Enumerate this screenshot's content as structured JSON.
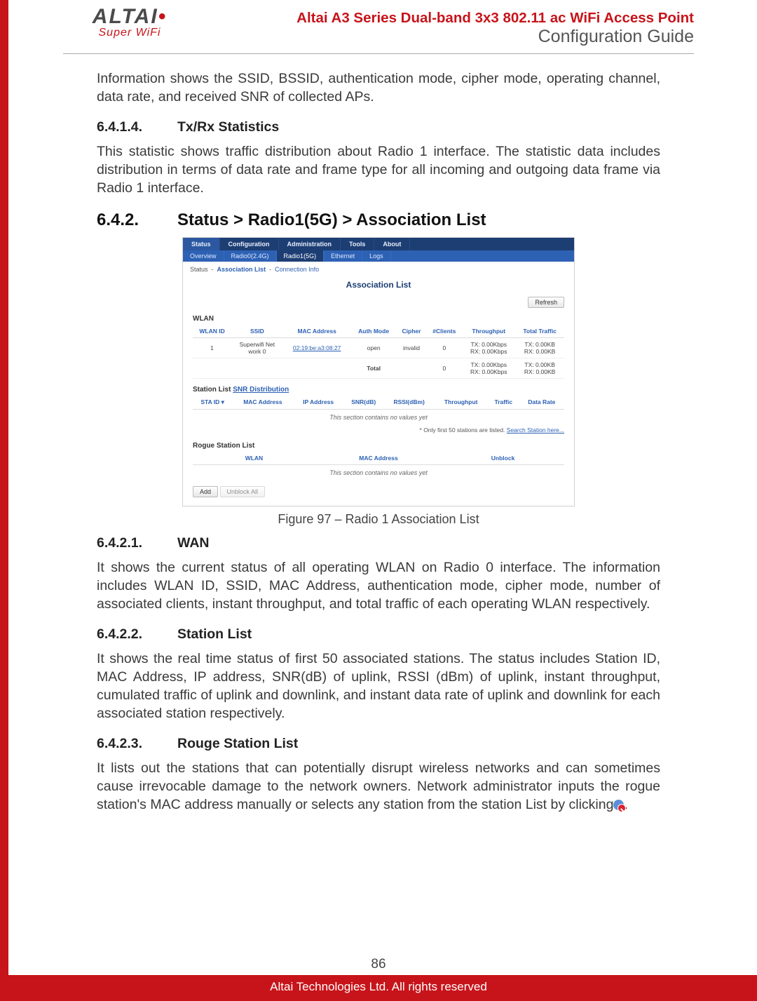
{
  "header": {
    "logo_top": "ALTAI",
    "logo_sub": "Super WiFi",
    "line1": "Altai A3 Series Dual-band 3x3 802.11 ac WiFi Access Point",
    "line2": "Configuration Guide"
  },
  "intro_p": "Information shows the SSID, BSSID, authentication mode, cipher mode, operating channel, data rate, and received SNR of collected APs.",
  "s6414": {
    "num": "6.4.1.4.",
    "title": "Tx/Rx Statistics",
    "p": "This statistic shows traffic distribution about Radio 1 interface. The statistic data includes distribution in terms of data rate and frame type for all incoming and outgoing data frame via Radio 1 interface."
  },
  "s642": {
    "num": "6.4.2.",
    "title": "Status > Radio1(5G) > Association List"
  },
  "figure_caption": "Figure 97 – Radio 1 Association List",
  "s6421": {
    "num": "6.4.2.1.",
    "title": "WAN",
    "p": "It shows the current status of all operating WLAN on Radio 0 interface. The information includes WLAN ID, SSID, MAC Address, authentication mode, cipher mode, number of associated clients, instant throughput, and total traffic of each operating WLAN respectively."
  },
  "s6422": {
    "num": "6.4.2.2.",
    "title": "Station List",
    "p": "It shows the real time status of first 50 associated stations. The status includes Station ID, MAC Address, IP address, SNR(dB) of uplink, RSSI (dBm) of uplink, instant throughput, cumulated traffic of uplink and downlink, and instant data rate of uplink and downlink for each associated station respectively."
  },
  "s6423": {
    "num": "6.4.2.3.",
    "title": "Rouge Station List",
    "p_pre": "It lists out the stations that can potentially disrupt wireless networks and can sometimes cause irrevocable damage to the network owners. Network administrator inputs the rogue station's MAC address manually or selects any station from the station List by clicking",
    "p_post": "."
  },
  "shot": {
    "tabs1": [
      "Status",
      "Configuration",
      "Administration",
      "Tools",
      "About"
    ],
    "tabs2": [
      "Overview",
      "Radio0(2.4G)",
      "Radio1(5G)",
      "Ethernet",
      "Logs"
    ],
    "crumb_status": "Status",
    "crumb_sep": "-",
    "crumb_assoc": "Association List",
    "crumb_conn": "Connection Info",
    "title": "Association List",
    "refresh": "Refresh",
    "wlan_h": "WLAN",
    "wlan_cols": [
      "WLAN ID",
      "SSID",
      "MAC Address",
      "Auth Mode",
      "Cipher",
      "#Clients",
      "Throughput",
      "Total Traffic"
    ],
    "wlan_row": {
      "id": "1",
      "ssid_l1": "Superwifi Net",
      "ssid_l2": "work 0",
      "mac": "02:19:be:a3:08:27",
      "auth": "open",
      "cipher": "invalid",
      "clients": "0",
      "tp_tx": "TX: 0.00Kbps",
      "tp_rx": "RX: 0.00Kbps",
      "tt_tx": "TX: 0.00KB",
      "tt_rx": "RX: 0.00KB"
    },
    "wlan_total": {
      "label": "Total",
      "clients": "0",
      "tp_tx": "TX: 0.00Kbps",
      "tp_rx": "RX: 0.00Kbps",
      "tt_tx": "TX: 0.00KB",
      "tt_rx": "RX: 0.00KB"
    },
    "station_h_pre": "Station List ",
    "station_h_link": "SNR Distribution",
    "station_cols": [
      "STA ID ▾",
      "MAC Address",
      "IP Address",
      "SNR(dB)",
      "RSSI(dBm)",
      "Throughput",
      "Traffic",
      "Data Rate"
    ],
    "empty": "This section contains no values yet",
    "note_pre": "* Only first 50 stations are listed. ",
    "note_link": "Search Station here...",
    "rogue_h": "Rogue Station List",
    "rogue_cols": [
      "WLAN",
      "MAC Address",
      "Unblock"
    ],
    "btn_add": "Add",
    "btn_unblock": "Unblock All"
  },
  "footer": {
    "page": "86",
    "copyright": "Altai Technologies Ltd. All rights reserved"
  }
}
